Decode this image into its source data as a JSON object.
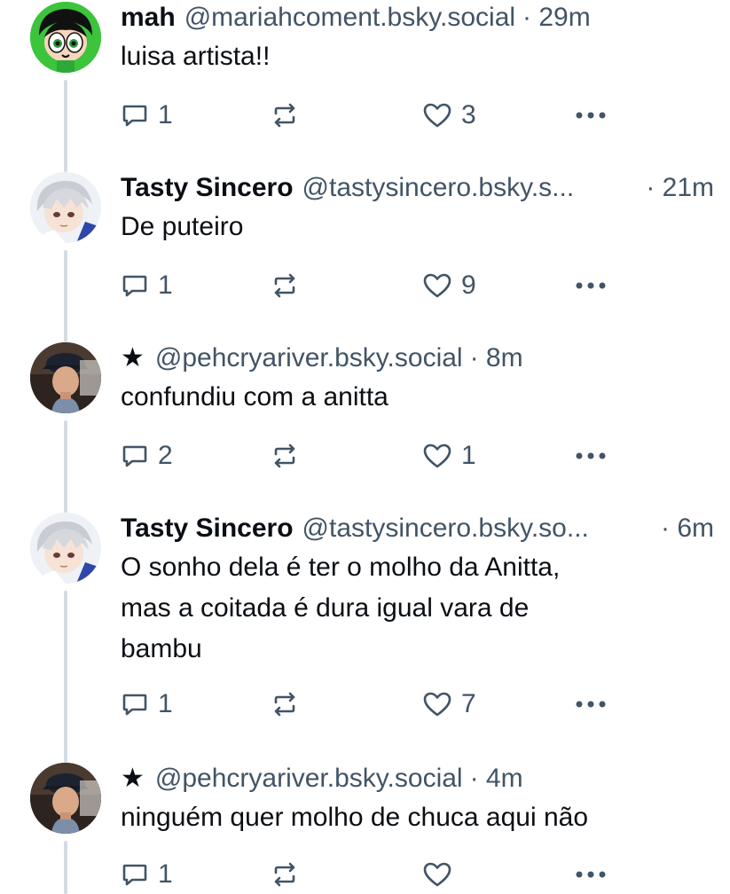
{
  "posts": [
    {
      "name": "mah",
      "handle": "@mariahcoment.bsky.social",
      "time": "· 29m",
      "text": "luisa artista!!",
      "replies": "1",
      "reposts": "",
      "likes": "3",
      "avatar": "powerpuff-girl-avatar",
      "colors": {
        "avatar_bg": "#3cc43c"
      }
    },
    {
      "name": "Tasty Sincero",
      "handle": "@tastysincero.bsky.s...",
      "time": "· 21m",
      "text": "De puteiro",
      "replies": "1",
      "reposts": "",
      "likes": "9",
      "avatar": "anime-character-avatar"
    },
    {
      "name": "★",
      "handle": "@pehcryariver.bsky.social",
      "time": "· 8m",
      "text": "confundiu com a anitta",
      "replies": "2",
      "reposts": "",
      "likes": "1",
      "avatar": "person-with-cap-avatar"
    },
    {
      "name": "Tasty Sincero",
      "handle": "@tastysincero.bsky.so...",
      "time": "· 6m",
      "text_lines": [
        "O sonho dela é ter o molho da Anitta,",
        "mas a coitada é dura igual vara de",
        "bambu"
      ],
      "replies": "1",
      "reposts": "",
      "likes": "7",
      "avatar": "anime-character-avatar"
    },
    {
      "name": "★",
      "handle": "@pehcryariver.bsky.social",
      "time": "· 4m",
      "text": "ninguém quer molho de chuca aqui não",
      "replies": "1",
      "reposts": "",
      "likes": "",
      "avatar": "person-with-cap-avatar"
    }
  ],
  "colors": {
    "text": "#0b0f14",
    "muted": "#425466",
    "thread_line": "#d4dbe2"
  }
}
